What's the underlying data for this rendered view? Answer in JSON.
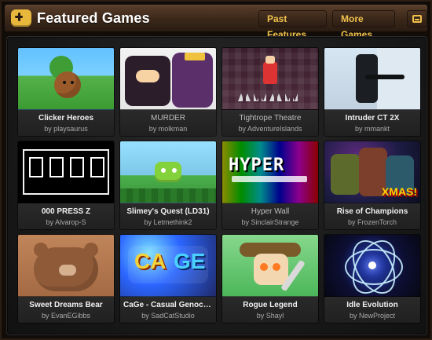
{
  "header": {
    "title": "Featured Games",
    "buttons": {
      "past": "Past Features",
      "more": "More Games"
    },
    "icons": {
      "logo": "gamepad-icon",
      "extra": "window-icon"
    }
  },
  "games": [
    {
      "title": "Clicker Heroes",
      "by": "by playsaurus",
      "title_style": "bold"
    },
    {
      "title": "MURDER",
      "by": "by molkman",
      "title_style": "dim"
    },
    {
      "title": "Tightrope Theatre",
      "by": "by AdventureIslands",
      "title_style": "dim"
    },
    {
      "title": "Intruder CT 2X",
      "by": "by mmankt",
      "title_style": "bold"
    },
    {
      "title": "000 PRESS Z",
      "by": "by Alvarop-S",
      "title_style": "bold"
    },
    {
      "title": "Slimey's Quest (LD31)",
      "by": "by Letmethink2",
      "title_style": "bold"
    },
    {
      "title": "Hyper Wall",
      "by": "by SinclairStrange",
      "title_style": "dim"
    },
    {
      "title": "Rise of Champions",
      "by": "by FrozenTorch",
      "title_style": "bold"
    },
    {
      "title": "Sweet Dreams Bear",
      "by": "by EvanEGibbs",
      "title_style": "bold"
    },
    {
      "title": "CaGe - Casual Genocide",
      "by": "by SadCatStudio",
      "title_style": "bold"
    },
    {
      "title": "Rogue Legend",
      "by": "by Shayl",
      "title_style": "bold"
    },
    {
      "title": "Idle Evolution",
      "by": "by NewProject",
      "title_style": "bold"
    }
  ]
}
